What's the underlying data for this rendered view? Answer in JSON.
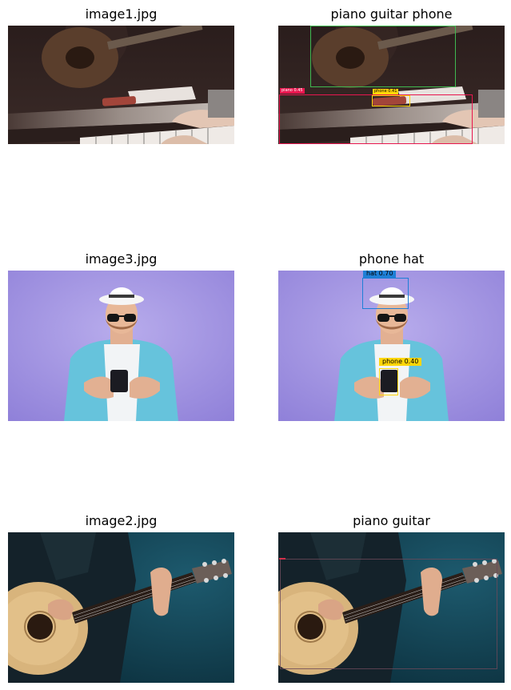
{
  "panels": [
    {
      "title": "image1.jpg",
      "scene": "piano-guitar-scene"
    },
    {
      "title": "piano guitar phone",
      "scene": "piano-guitar-scene"
    },
    {
      "title": "image3.jpg",
      "scene": "man-hat-phone-scene"
    },
    {
      "title": "phone hat",
      "scene": "man-hat-phone-scene"
    },
    {
      "title": "image2.jpg",
      "scene": "acoustic-guitar-scene"
    },
    {
      "title": "piano guitar",
      "scene": "acoustic-guitar-scene"
    }
  ],
  "detections": {
    "panel2": [
      {
        "label": "piano 0.45",
        "color": "#e8174f"
      },
      {
        "label": "phone 0.41",
        "color": "#ffd60a"
      },
      {
        "label": "guitar",
        "color": "#3fb950"
      }
    ],
    "panel4": [
      {
        "label": "hat 0.70",
        "color": "#1e7fd6"
      },
      {
        "label": "phone 0.40",
        "color": "#ffd60a"
      }
    ],
    "panel6": [
      {
        "label": "piano",
        "color": "#9b3b4f"
      },
      {
        "label": "guitar",
        "color": "#6b4a5a"
      }
    ]
  }
}
